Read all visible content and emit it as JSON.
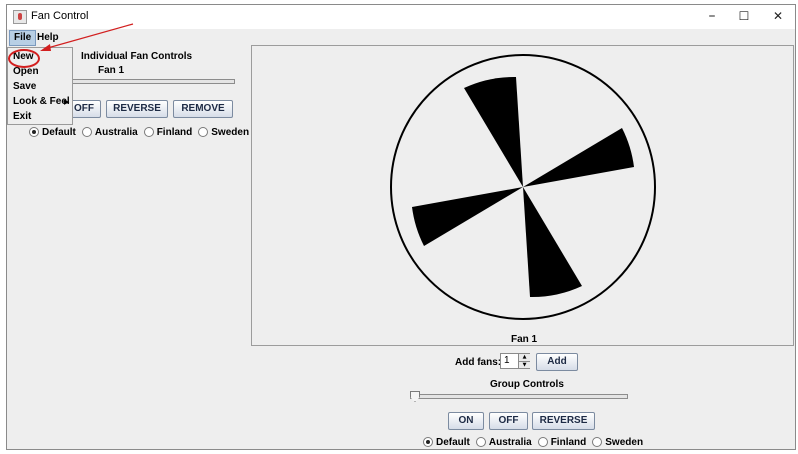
{
  "window": {
    "title": "Fan Control",
    "controls": {
      "minimize": "–",
      "maximize": "☐",
      "close": "✕"
    }
  },
  "menubar": {
    "items": [
      "File",
      "Help"
    ],
    "active": "File"
  },
  "file_menu": {
    "items": [
      "New",
      "Open",
      "Save",
      "Look & Feel",
      "Exit"
    ],
    "submenu_arrow": "▶",
    "highlighted": "New"
  },
  "individual_controls": {
    "heading": "Individual Fan Controls",
    "fan_name": "Fan 1",
    "speed_level": 0,
    "buttons": {
      "off": "OFF",
      "reverse": "REVERSE",
      "remove": "REMOVE"
    },
    "themes": [
      "Default",
      "Australia",
      "Finland",
      "Sweden"
    ],
    "selected_theme": "Default"
  },
  "fan_display": {
    "caption": "Fan 1",
    "blade_count": 4
  },
  "add_fans": {
    "label": "Add fans:",
    "value": "1",
    "button": "Add",
    "spin_up": "▲",
    "spin_down": "▼"
  },
  "group_controls": {
    "heading": "Group Controls",
    "speed_level": 0,
    "buttons": {
      "on": "ON",
      "off": "OFF",
      "reverse": "REVERSE"
    },
    "themes": [
      "Default",
      "Australia",
      "Finland",
      "Sweden"
    ],
    "selected_theme": "Default"
  },
  "colors": {
    "annotation": "#d21f1f",
    "menu_highlight": "#b8cfe5",
    "blade": "#000000"
  }
}
